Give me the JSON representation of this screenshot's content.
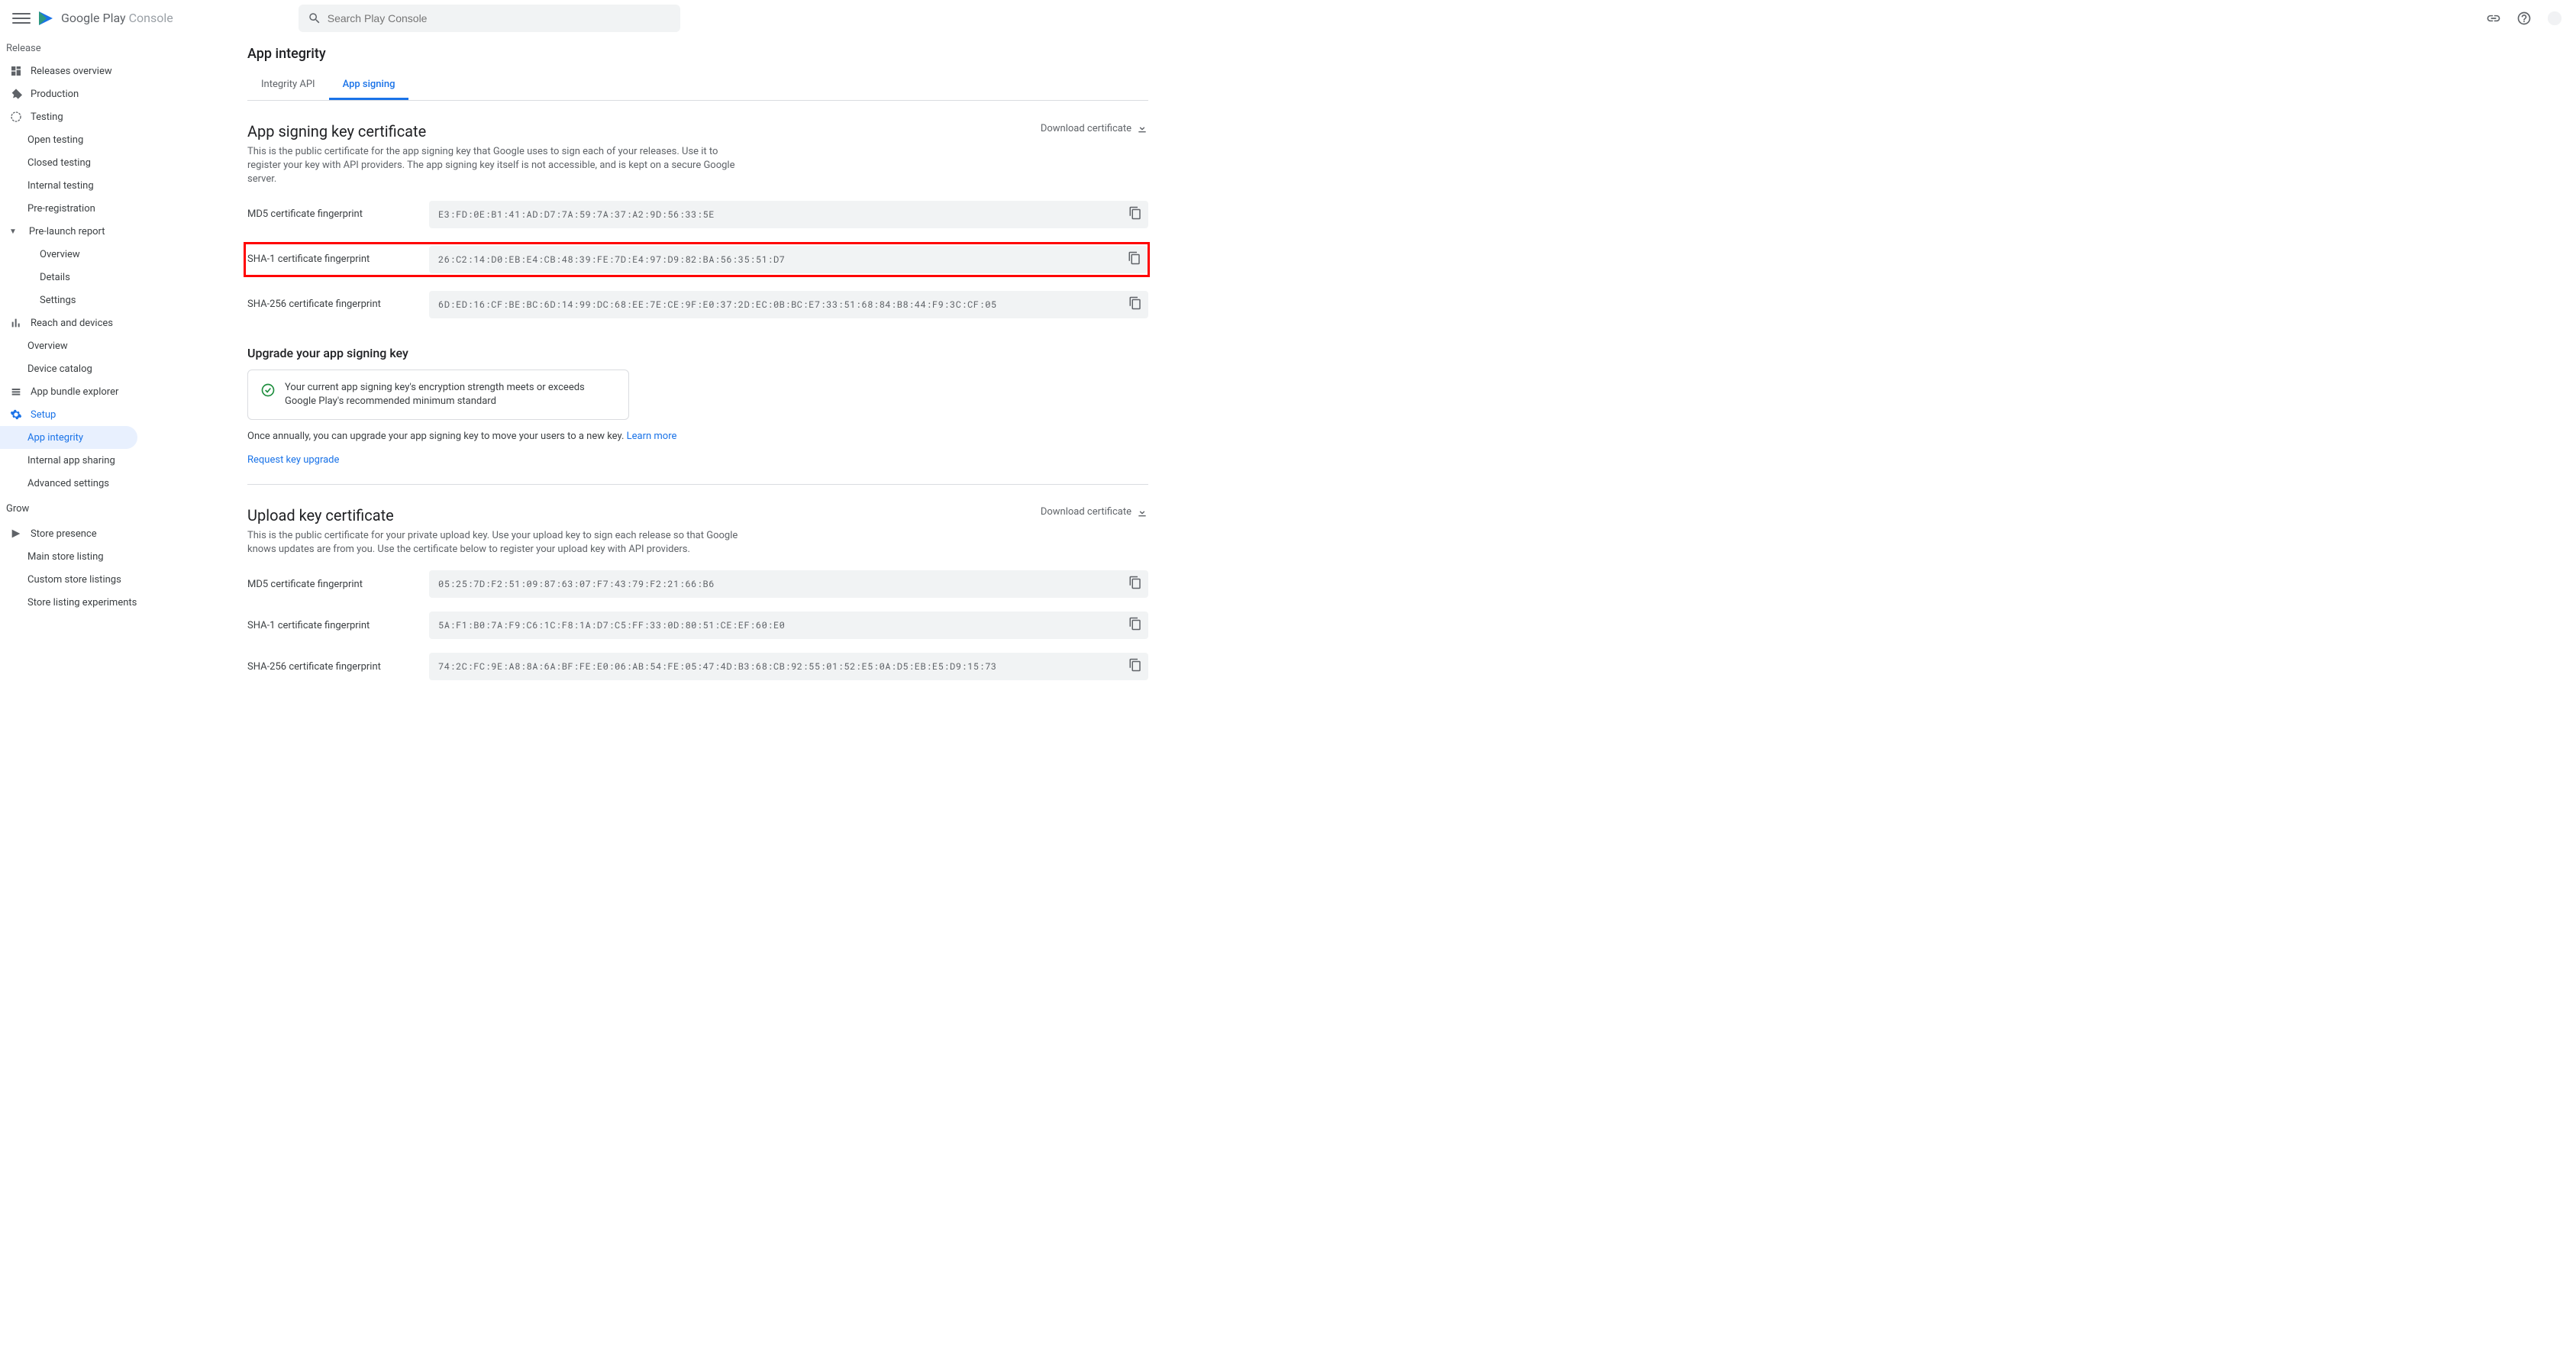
{
  "header": {
    "brand": "Google Play ",
    "brandSuffix": "Console",
    "searchPlaceholder": "Search Play Console"
  },
  "sidebar": {
    "truncatedTop": "Release",
    "items": {
      "releasesOverview": "Releases overview",
      "production": "Production",
      "testing": "Testing",
      "openTesting": "Open testing",
      "closedTesting": "Closed testing",
      "internalTesting": "Internal testing",
      "preRegistration": "Pre-registration",
      "preLaunch": "Pre-launch report",
      "plOverview": "Overview",
      "plDetails": "Details",
      "plSettings": "Settings",
      "reachDevices": "Reach and devices",
      "rdOverview": "Overview",
      "deviceCatalog": "Device catalog",
      "appBundle": "App bundle explorer",
      "setup": "Setup",
      "appIntegrity": "App integrity",
      "internalSharing": "Internal app sharing",
      "advancedSettings": "Advanced settings"
    },
    "sectionGrow": "Grow",
    "grow": {
      "storePresence": "Store presence",
      "mainListing": "Main store listing",
      "customListings": "Custom store listings",
      "experiments": "Store listing experiments"
    }
  },
  "page": {
    "title": "App integrity",
    "tabs": {
      "integrity": "Integrity API",
      "signing": "App signing"
    }
  },
  "signingCert": {
    "title": "App signing key certificate",
    "desc": "This is the public certificate for the app signing key that Google uses to sign each of your releases. Use it to register your key with API providers. The app signing key itself is not accessible, and is kept on a secure Google server.",
    "download": "Download certificate",
    "md5Label": "MD5 certificate fingerprint",
    "md5Value": "E3:FD:0E:B1:41:AD:D7:7A:59:7A:37:A2:9D:56:33:5E",
    "sha1Label": "SHA-1 certificate fingerprint",
    "sha1Value": "26:C2:14:D0:EB:E4:CB:48:39:FE:7D:E4:97:D9:82:BA:56:35:51:D7",
    "sha256Label": "SHA-256 certificate fingerprint",
    "sha256Value": "6D:ED:16:CF:BE:BC:6D:14:99:DC:68:EE:7E:CE:9F:E0:37:2D:EC:0B:BC:E7:33:51:68:84:B8:44:F9:3C:CF:05"
  },
  "upgrade": {
    "title": "Upgrade your app signing key",
    "cardText": "Your current app signing key's encryption strength meets or exceeds Google Play's recommended minimum standard",
    "annual": "Once annually, you can upgrade your app signing key to move your users to a new key. ",
    "learnMore": "Learn more",
    "request": "Request key upgrade"
  },
  "uploadCert": {
    "title": "Upload key certificate",
    "desc": "This is the public certificate for your private upload key. Use your upload key to sign each release so that Google knows updates are from you. Use the certificate below to register your upload key with API providers.",
    "download": "Download certificate",
    "md5Label": "MD5 certificate fingerprint",
    "md5Value": "05:25:7D:F2:51:09:87:63:07:F7:43:79:F2:21:66:B6",
    "sha1Label": "SHA-1 certificate fingerprint",
    "sha1Value": "5A:F1:B0:7A:F9:C6:1C:F8:1A:D7:C5:FF:33:0D:80:51:CE:EF:60:E0",
    "sha256Label": "SHA-256 certificate fingerprint",
    "sha256Value": "74:2C:FC:9E:A8:8A:6A:BF:FE:E0:06:AB:54:FE:05:47:4D:B3:68:CB:92:55:01:52:E5:0A:D5:EB:E5:D9:15:73"
  }
}
